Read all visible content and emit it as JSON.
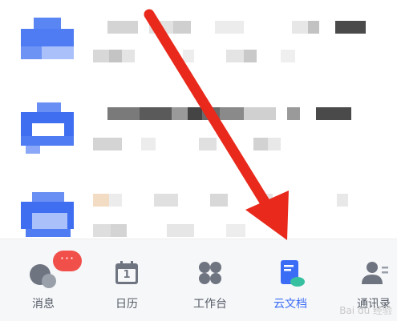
{
  "tabs": [
    {
      "label": "消息",
      "icon": "chat-bubble-icon",
      "badge": "···",
      "active": false
    },
    {
      "label": "日历",
      "icon": "calendar-icon",
      "day": "1",
      "active": false
    },
    {
      "label": "工作台",
      "icon": "grid-apps-icon",
      "active": false
    },
    {
      "label": "云文档",
      "icon": "cloud-document-icon",
      "active": true
    },
    {
      "label": "通讯录",
      "icon": "contacts-icon",
      "active": false
    }
  ],
  "colors": {
    "accent": "#3b6cf6",
    "avatar_blue": "#4f7cf2",
    "badge_red": "#f1504a",
    "arrow_red": "#e8291b"
  },
  "annotation": {
    "icon": "red-arrow-pointer-icon"
  }
}
